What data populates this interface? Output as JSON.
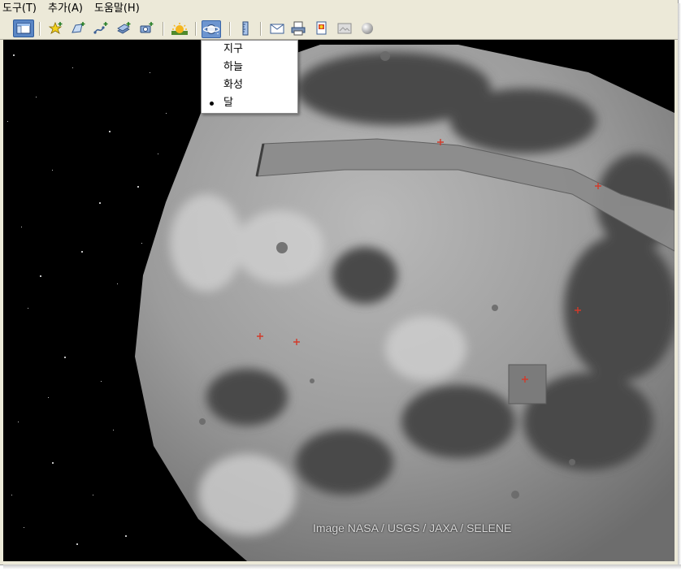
{
  "menu": [
    {
      "name": "menu-tools",
      "label": "도구(T)"
    },
    {
      "name": "menu-add",
      "label": "추가(A)"
    },
    {
      "name": "menu-help",
      "label": "도움말(H)"
    }
  ],
  "toolbar": {
    "icons": [
      "sidebar-toggle-icon",
      "add-placemark-icon",
      "add-polygon-icon",
      "add-path-icon",
      "add-image-overlay-icon",
      "record-tour-icon",
      "historical-imagery-icon",
      "planet-switch-icon",
      "ruler-icon",
      "email-icon",
      "print-icon",
      "save-image-icon",
      "view-in-maps-icon",
      "sphere-icon"
    ]
  },
  "planet_menu": {
    "items": [
      {
        "label": "지구",
        "checked": false
      },
      {
        "label": "하늘",
        "checked": false
      },
      {
        "label": "화성",
        "checked": false
      },
      {
        "label": "달",
        "checked": true
      }
    ]
  },
  "viewport": {
    "attribution": "Image NASA / USGS / JAXA / SELENE"
  },
  "colors": {
    "menubar_bg": "#ece9d8",
    "toolbar_active": "#5a86c4",
    "space": "#000000"
  }
}
